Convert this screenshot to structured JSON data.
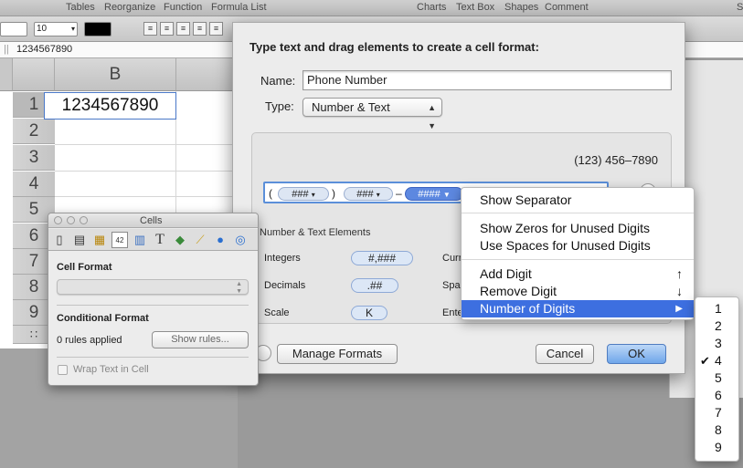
{
  "toolbar": {
    "items": [
      "Tables",
      "Reorganize",
      "Function",
      "Formula List",
      "Charts",
      "Text Box",
      "Shapes",
      "Comment",
      "S"
    ]
  },
  "format_bar": {
    "font_size": "10"
  },
  "formula_bar": {
    "value": "1234567890"
  },
  "sheet": {
    "column_header": "B",
    "rows": [
      "1",
      "2",
      "3",
      "4",
      "5",
      "6",
      "7",
      "8",
      "9"
    ],
    "cell_b1": "1234567890"
  },
  "dialog": {
    "title": "Type text and drag elements to create a cell format:",
    "name_label": "Name:",
    "name_value": "Phone Number",
    "type_label": "Type:",
    "type_value": "Number & Text",
    "preview": "(123) 456–7890",
    "format_tokens": {
      "open_paren": "(",
      "token1": "###",
      "close_paren": ")",
      "token2": "###",
      "dash": "–",
      "token3": "####"
    },
    "elements_header": "Number & Text Elements",
    "elements": [
      {
        "label": "Integers",
        "pill": "#,###"
      },
      {
        "label": "Decimals",
        "pill": ".##"
      },
      {
        "label": "Scale",
        "pill": "K"
      }
    ],
    "elements_right": [
      "Curr",
      "Spac",
      "Ente"
    ],
    "manage_formats": "Manage Formats",
    "cancel": "Cancel",
    "ok": "OK"
  },
  "context_menu": {
    "show_separator": "Show Separator",
    "show_zeros": "Show Zeros for Unused Digits",
    "use_spaces": "Use Spaces for Unused Digits",
    "add_digit": "Add Digit",
    "add_digit_key": "↑",
    "remove_digit": "Remove Digit",
    "remove_digit_key": "↓",
    "number_of_digits": "Number of Digits",
    "submenu_arrow": "▶"
  },
  "digits_submenu": {
    "items": [
      "1",
      "2",
      "3",
      "4",
      "5",
      "6",
      "7",
      "8",
      "9"
    ],
    "checked": "4",
    "checkmark": "✔"
  },
  "inspector": {
    "title": "Cells",
    "cell_format": "Cell Format",
    "conditional_format": "Conditional Format",
    "rules_applied": "0 rules applied",
    "show_rules": "Show rules...",
    "wrap_text": "Wrap Text in Cell",
    "tab_icons": [
      "document-icon",
      "sidebar-icon",
      "table-icon",
      "cell-format-icon",
      "chart-icon",
      "text-icon",
      "shapes-icon",
      "ruler-icon",
      "link-icon",
      "quicktime-icon"
    ],
    "active_tab_text": "42"
  },
  "colors": {
    "accent": "#3d6fe0",
    "token_selected": "#5d88e0",
    "cell_border": "#4a78c8"
  }
}
